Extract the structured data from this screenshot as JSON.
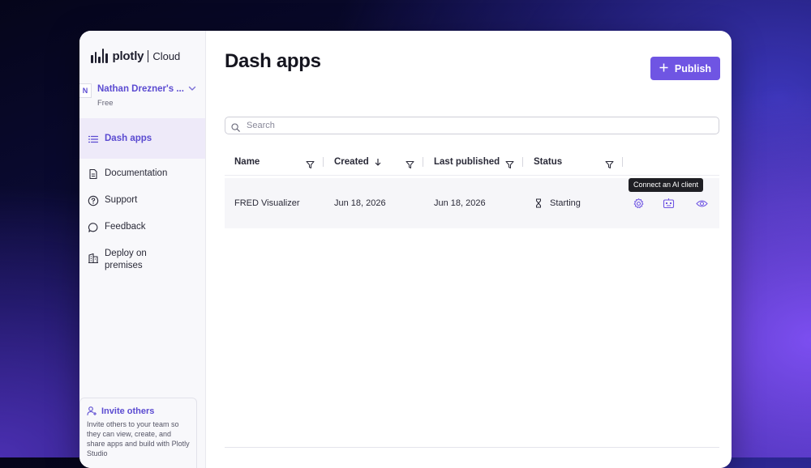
{
  "brand": {
    "name": "plotly",
    "product": "Cloud"
  },
  "team": {
    "avatar_letter": "N",
    "name": "Nathan Drezner's ...",
    "plan": "Free"
  },
  "sidebar": {
    "items": [
      {
        "label": "Dash apps",
        "icon": "list-icon",
        "active": true
      },
      {
        "label": "Documentation",
        "icon": "document-icon"
      },
      {
        "label": "Support",
        "icon": "help-circle-icon"
      },
      {
        "label": "Feedback",
        "icon": "chat-bubble-icon"
      },
      {
        "label": "Deploy on premises",
        "icon": "building-icon"
      }
    ],
    "invite": {
      "title": "Invite others",
      "text": "Invite others to your team so they can view, create, and share apps and build with Plotly Studio"
    }
  },
  "main": {
    "title": "Dash apps",
    "publish_label": "Publish",
    "search_placeholder": "Search",
    "columns": [
      "Name",
      "Created",
      "Last published",
      "Status"
    ],
    "rows": [
      {
        "name": "FRED Visualizer",
        "created": "Jun 18, 2026",
        "last_published": "Jun 18, 2026",
        "status": "Starting"
      }
    ],
    "tooltip": "Connect an AI client"
  },
  "colors": {
    "accent": "#6f55e3",
    "accent_text": "#5b4bd1"
  }
}
